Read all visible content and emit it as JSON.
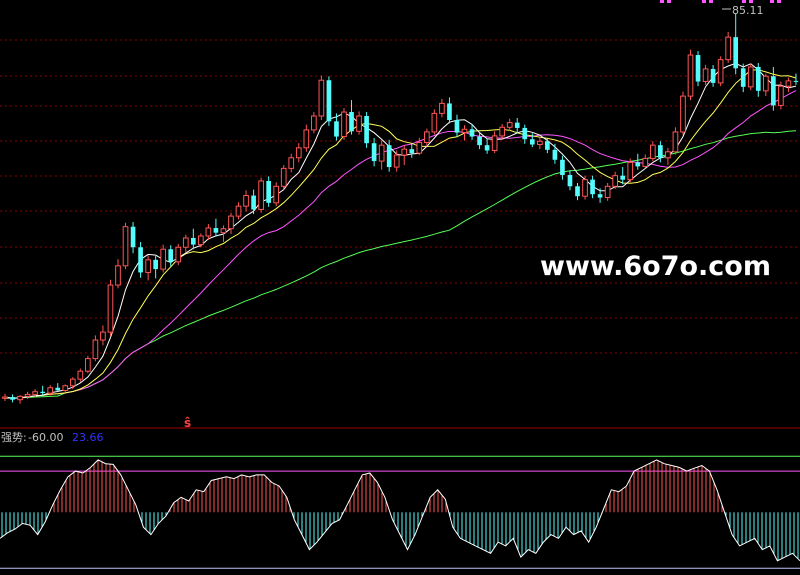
{
  "chart_data": [
    {
      "type": "candlestick",
      "title": "",
      "annotations": {
        "high_label": "85.11",
        "signal_marker": "ŝ",
        "watermark": "www.6o7o.com"
      },
      "colors": {
        "up": "#ff5555",
        "down": "#54fcfc",
        "ma5": "#ffffff",
        "ma10": "#ffff55",
        "ma20": "#ff55ff",
        "ma60": "#55ff55",
        "grid": "#8a0000"
      },
      "ohlc": [
        [
          27.0,
          27.7,
          26.6,
          27.2
        ],
        [
          27.2,
          27.6,
          26.4,
          26.8
        ],
        [
          26.8,
          27.5,
          26.2,
          27.3
        ],
        [
          27.3,
          28.0,
          26.9,
          27.6
        ],
        [
          27.6,
          28.4,
          27.2,
          28.0
        ],
        [
          28.0,
          28.9,
          27.5,
          27.8
        ],
        [
          27.8,
          29.0,
          27.4,
          28.6
        ],
        [
          28.6,
          29.3,
          28.0,
          28.2
        ],
        [
          28.2,
          29.1,
          27.9,
          28.9
        ],
        [
          28.9,
          30.2,
          28.4,
          29.9
        ],
        [
          29.9,
          31.5,
          29.5,
          31.1
        ],
        [
          31.1,
          33.4,
          30.8,
          33.0
        ],
        [
          33.0,
          36.5,
          32.6,
          35.8
        ],
        [
          35.8,
          38.0,
          35.0,
          37.0
        ],
        [
          37.0,
          44.9,
          36.4,
          44.1
        ],
        [
          44.1,
          48.0,
          43.6,
          47.0
        ],
        [
          47.0,
          53.5,
          46.5,
          52.9
        ],
        [
          52.9,
          53.6,
          48.9,
          49.8
        ],
        [
          49.8,
          50.6,
          45.2,
          46.0
        ],
        [
          46.0,
          48.6,
          44.8,
          47.9
        ],
        [
          47.9,
          48.5,
          45.1,
          46.5
        ],
        [
          46.5,
          50.2,
          46.0,
          49.5
        ],
        [
          49.5,
          50.1,
          46.9,
          47.6
        ],
        [
          47.6,
          50.3,
          47.1,
          49.8
        ],
        [
          49.8,
          51.7,
          49.0,
          51.2
        ],
        [
          51.2,
          52.6,
          49.5,
          50.2
        ],
        [
          50.2,
          51.9,
          49.8,
          51.5
        ],
        [
          51.5,
          53.3,
          50.9,
          52.7
        ],
        [
          52.7,
          54.1,
          51.4,
          52.0
        ],
        [
          52.0,
          53.1,
          50.6,
          52.6
        ],
        [
          52.6,
          55.0,
          51.8,
          54.5
        ],
        [
          54.5,
          56.6,
          54.0,
          56.0
        ],
        [
          56.0,
          58.4,
          55.2,
          57.6
        ],
        [
          57.6,
          58.5,
          54.8,
          55.5
        ],
        [
          55.5,
          60.3,
          55.0,
          59.8
        ],
        [
          59.8,
          60.5,
          55.9,
          56.5
        ],
        [
          56.5,
          59.6,
          56.0,
          59.0
        ],
        [
          59.0,
          62.2,
          58.5,
          61.7
        ],
        [
          61.7,
          63.9,
          61.1,
          63.3
        ],
        [
          63.3,
          65.5,
          62.6,
          64.8
        ],
        [
          64.8,
          68.3,
          64.2,
          67.5
        ],
        [
          67.5,
          70.2,
          67.0,
          69.6
        ],
        [
          69.6,
          75.7,
          69.0,
          75.0
        ],
        [
          75.0,
          75.6,
          68.1,
          68.8
        ],
        [
          68.8,
          70.0,
          65.9,
          66.5
        ],
        [
          66.5,
          70.8,
          66.0,
          70.2
        ],
        [
          70.2,
          72.0,
          66.8,
          67.3
        ],
        [
          67.3,
          70.3,
          66.8,
          69.6
        ],
        [
          69.6,
          70.2,
          64.8,
          65.5
        ],
        [
          65.5,
          66.3,
          62.0,
          62.8
        ],
        [
          62.8,
          65.9,
          61.5,
          65.2
        ],
        [
          65.2,
          66.0,
          61.2,
          61.9
        ],
        [
          61.9,
          64.4,
          61.2,
          63.7
        ],
        [
          63.7,
          65.2,
          62.2,
          64.6
        ],
        [
          64.6,
          65.4,
          63.3,
          64.0
        ],
        [
          64.0,
          66.3,
          63.7,
          65.6
        ],
        [
          65.6,
          67.7,
          65.0,
          67.2
        ],
        [
          67.2,
          70.6,
          66.8,
          70.0
        ],
        [
          70.0,
          72.2,
          69.4,
          71.5
        ],
        [
          71.5,
          72.4,
          68.5,
          69.0
        ],
        [
          69.0,
          69.8,
          66.4,
          67.1
        ],
        [
          67.1,
          68.2,
          65.9,
          67.6
        ],
        [
          67.6,
          68.4,
          66.0,
          66.5
        ],
        [
          66.5,
          67.2,
          64.6,
          65.2
        ],
        [
          65.2,
          66.2,
          63.9,
          64.4
        ],
        [
          64.4,
          67.3,
          64.0,
          66.6
        ],
        [
          66.6,
          68.4,
          66.0,
          67.9
        ],
        [
          67.9,
          69.2,
          67.4,
          68.6
        ],
        [
          68.6,
          69.3,
          67.0,
          67.8
        ],
        [
          67.8,
          68.3,
          65.4,
          66.1
        ],
        [
          66.1,
          67.0,
          64.9,
          65.3
        ],
        [
          65.3,
          66.4,
          64.6,
          65.8
        ],
        [
          65.8,
          66.3,
          64.0,
          64.5
        ],
        [
          64.5,
          65.4,
          62.4,
          63.0
        ],
        [
          63.0,
          63.6,
          60.0,
          60.7
        ],
        [
          60.7,
          61.4,
          58.4,
          59.0
        ],
        [
          59.0,
          59.5,
          56.9,
          57.5
        ],
        [
          57.5,
          60.6,
          57.0,
          60.0
        ],
        [
          60.0,
          60.6,
          57.2,
          57.8
        ],
        [
          57.8,
          58.7,
          56.5,
          57.3
        ],
        [
          57.3,
          59.5,
          56.8,
          59.0
        ],
        [
          59.0,
          61.2,
          58.6,
          60.6
        ],
        [
          60.6,
          61.9,
          59.3,
          60.0
        ],
        [
          60.0,
          63.2,
          59.6,
          62.6
        ],
        [
          62.6,
          63.9,
          61.5,
          62.0
        ],
        [
          62.0,
          63.8,
          61.7,
          63.2
        ],
        [
          63.2,
          65.8,
          62.8,
          65.2
        ],
        [
          65.2,
          65.8,
          62.6,
          63.3
        ],
        [
          63.3,
          64.8,
          62.2,
          64.2
        ],
        [
          64.2,
          67.9,
          63.8,
          67.2
        ],
        [
          67.2,
          73.3,
          66.8,
          72.6
        ],
        [
          72.6,
          79.6,
          72.0,
          78.8
        ],
        [
          78.8,
          79.4,
          74.1,
          74.8
        ],
        [
          74.8,
          77.3,
          74.3,
          76.7
        ],
        [
          76.7,
          77.3,
          74.0,
          74.6
        ],
        [
          74.6,
          78.6,
          74.1,
          78.1
        ],
        [
          78.1,
          82.3,
          77.6,
          81.5
        ],
        [
          81.5,
          85.1,
          75.9,
          76.8
        ],
        [
          76.8,
          77.5,
          73.2,
          74.0
        ],
        [
          74.0,
          77.5,
          73.5,
          77.0
        ],
        [
          77.0,
          77.6,
          72.5,
          73.4
        ],
        [
          73.4,
          76.0,
          72.6,
          75.6
        ],
        [
          75.6,
          77.0,
          70.4,
          71.2
        ],
        [
          71.2,
          74.8,
          70.6,
          74.1
        ],
        [
          74.1,
          75.4,
          73.2,
          74.9
        ],
        [
          74.9,
          76.0,
          74.3,
          74.8
        ]
      ],
      "ylim": [
        26,
        86.5
      ]
    },
    {
      "type": "histogram",
      "title": "",
      "indicator_label": "强势:",
      "indicator_value": "-60.00",
      "secondary_value": "23.66",
      "colors": {
        "label": "#c0c0c0",
        "secondary": "#3232ff",
        "positive_bar": "#ff5555",
        "negative_bar": "#54fcfc",
        "line": "#ffffff",
        "upper_band": "#55ff55",
        "lower_band": "#ff55ff",
        "zero_band": "#c0c0ff"
      },
      "values": [
        -70,
        -55,
        -45,
        -30,
        -35,
        -60,
        -25,
        20,
        60,
        95,
        110,
        105,
        120,
        140,
        130,
        128,
        100,
        60,
        20,
        -40,
        -60,
        -30,
        -10,
        25,
        40,
        30,
        60,
        55,
        85,
        90,
        95,
        90,
        100,
        95,
        100,
        100,
        80,
        70,
        40,
        -20,
        -60,
        -100,
        -80,
        -55,
        -30,
        -20,
        20,
        60,
        100,
        105,
        80,
        40,
        -20,
        -60,
        -100,
        -60,
        -10,
        40,
        60,
        35,
        -40,
        -70,
        -80,
        -90,
        -100,
        -110,
        -80,
        -90,
        -70,
        -120,
        -100,
        -110,
        -80,
        -60,
        -70,
        -40,
        -60,
        -50,
        -80,
        -40,
        10,
        60,
        55,
        70,
        110,
        120,
        130,
        140,
        130,
        125,
        120,
        110,
        118,
        125,
        110,
        60,
        0,
        -60,
        -90,
        -80,
        -70,
        -100,
        -90,
        -130,
        -120,
        -110,
        -130
      ],
      "ylim": [
        -160,
        180
      ],
      "upper_band": 150,
      "lower_band": 110,
      "bottom_band": -150
    }
  ]
}
